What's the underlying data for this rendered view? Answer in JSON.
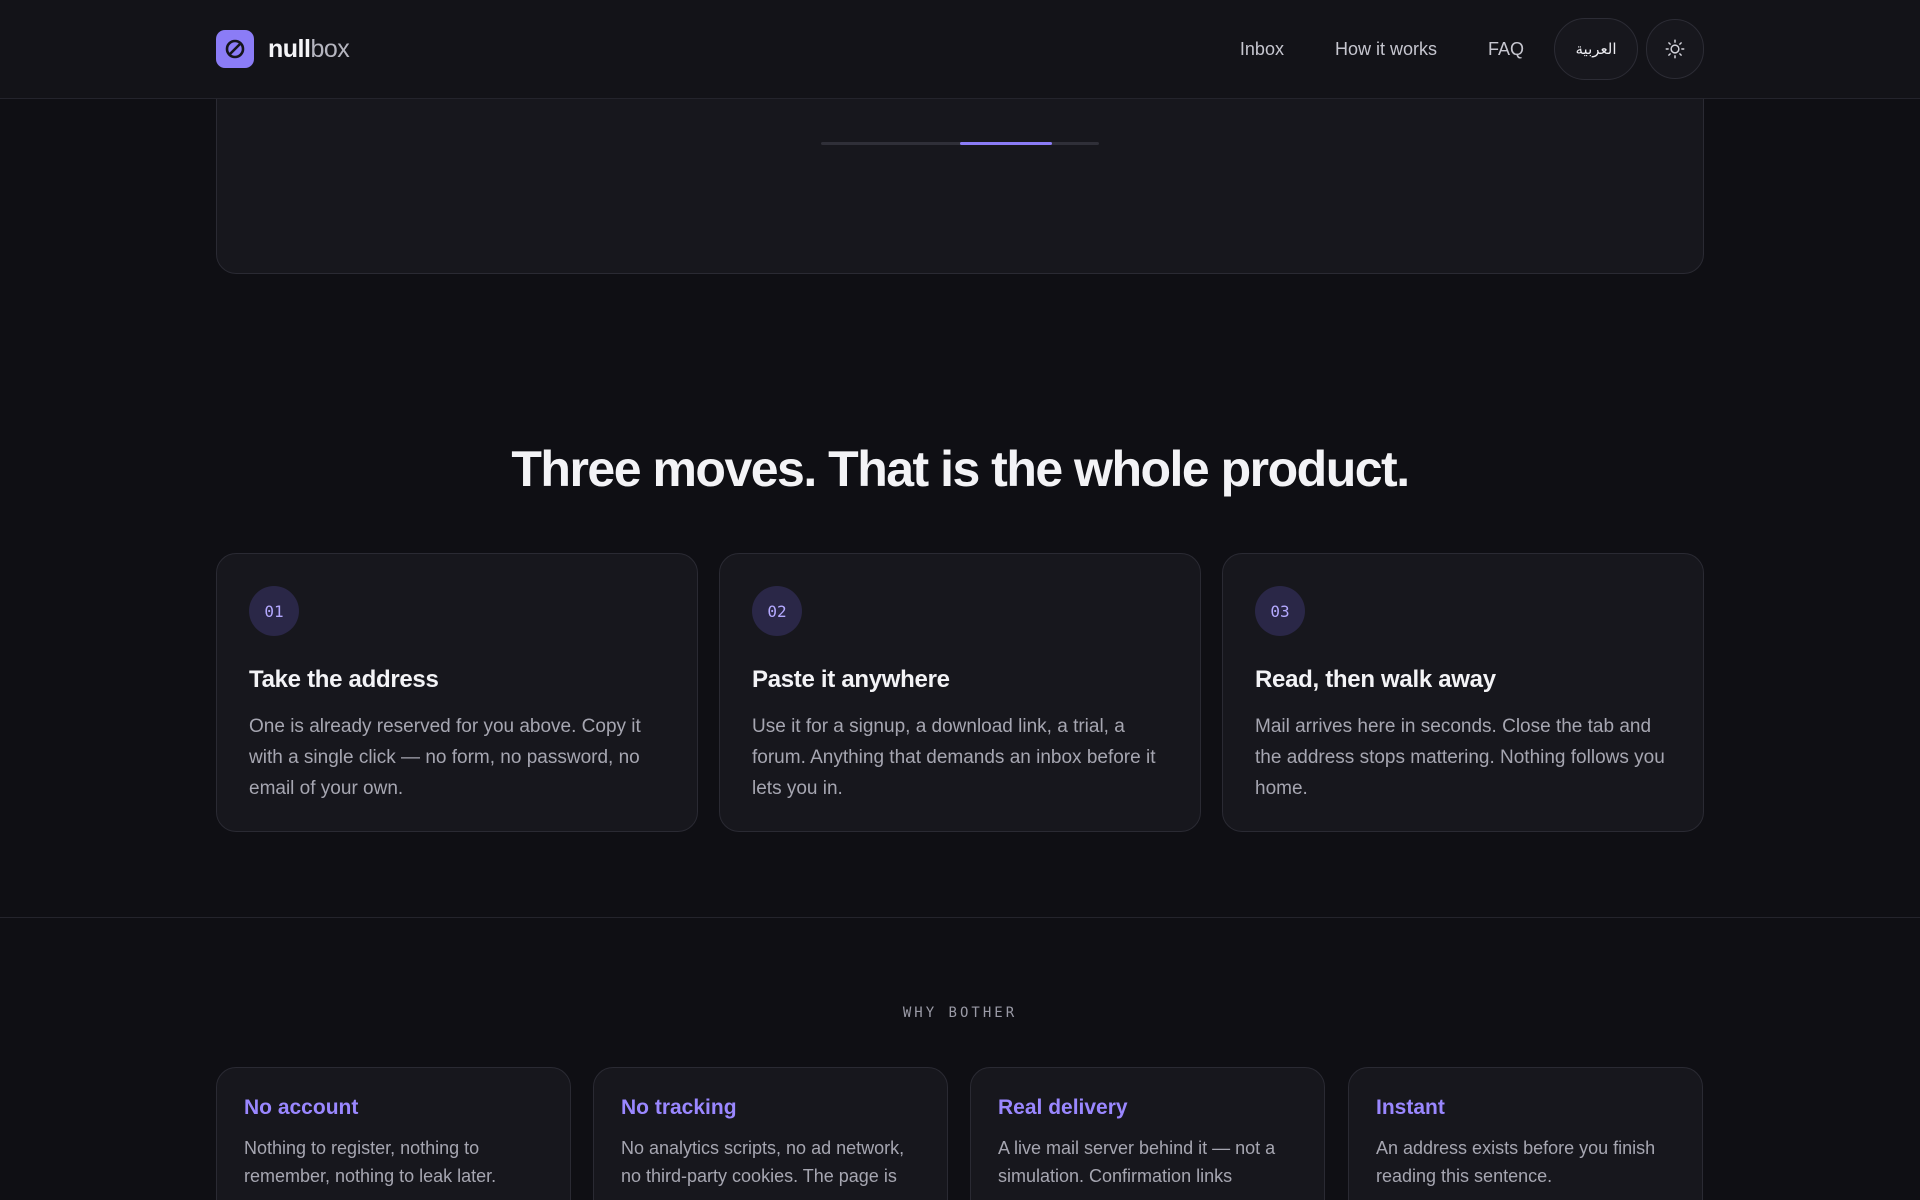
{
  "brand": {
    "name_strong": "null",
    "name_light": "box",
    "logo_icon": "null-sign-icon"
  },
  "nav": {
    "links": [
      "Inbox",
      "How it works",
      "FAQ"
    ],
    "language_label": "العربية",
    "theme_icon": "sun-icon"
  },
  "hero": {
    "progress": 0.33
  },
  "steps": {
    "title": "Three moves. That is the whole product.",
    "items": [
      {
        "num": "01",
        "title": "Take the address",
        "desc": "One is already reserved for you above. Copy it with a single click — no form, no password, no email of your own."
      },
      {
        "num": "02",
        "title": "Paste it anywhere",
        "desc": "Use it for a signup, a download link, a trial, a forum. Anything that demands an inbox before it lets you in."
      },
      {
        "num": "03",
        "title": "Read, then walk away",
        "desc": "Mail arrives here in seconds. Close the tab and the address stops mattering. Nothing follows you home."
      }
    ]
  },
  "why": {
    "eyebrow": "WHY BOTHER",
    "items": [
      {
        "title": "No account",
        "desc": "Nothing to register, nothing to remember, nothing to leak later."
      },
      {
        "title": "No tracking",
        "desc": "No analytics scripts, no ad network, no third-party cookies. The page is"
      },
      {
        "title": "Real delivery",
        "desc": "A live mail server behind it — not a simulation. Confirmation links"
      },
      {
        "title": "Instant",
        "desc": "An address exists before you finish reading this sentence."
      }
    ]
  },
  "colors": {
    "accent": "#8b7cf6",
    "background": "#0f0f14",
    "card": "#17171d"
  }
}
